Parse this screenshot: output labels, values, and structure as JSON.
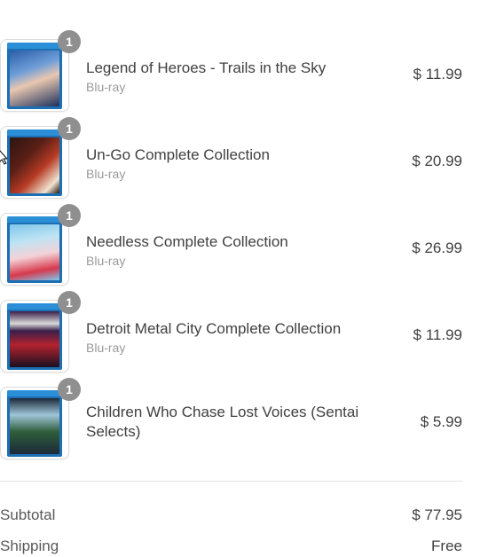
{
  "items": [
    {
      "title": "Legend of Heroes - Trails in the Sky",
      "format": "Blu-ray",
      "price": "$ 11.99",
      "quantity": "1",
      "cover_colors": [
        "#2a5ea8",
        "#e8c7b0",
        "#1b2f5c"
      ]
    },
    {
      "title": "Un-Go Complete Collection",
      "format": "Blu-ray",
      "price": "$ 20.99",
      "quantity": "1",
      "cover_colors": [
        "#2b1510",
        "#b63a24",
        "#efe3cf"
      ]
    },
    {
      "title": "Needless Complete Collection",
      "format": "Blu-ray",
      "price": "$ 26.99",
      "quantity": "1",
      "cover_colors": [
        "#7ec6ea",
        "#f3d2d7",
        "#d73a4e"
      ]
    },
    {
      "title": "Detroit Metal City Complete Collection",
      "format": "Blu-ray",
      "price": "$ 11.99",
      "quantity": "1",
      "cover_colors": [
        "#3a1f4a",
        "#d9d9d9",
        "#b2222e"
      ]
    },
    {
      "title": "Children Who Chase Lost Voices (Sentai Selects)",
      "format": "",
      "price": "$ 5.99",
      "quantity": "1",
      "cover_colors": [
        "#2f5d3a",
        "#9fc5d8",
        "#1c2a3a"
      ]
    }
  ],
  "summary": {
    "subtotal_label": "Subtotal",
    "subtotal_value": "$ 77.95",
    "shipping_label": "Shipping",
    "shipping_value": "Free"
  },
  "colors": {
    "badge": "#8f8f8f",
    "text": "#404040",
    "muted": "#9a9a9a",
    "bluray_band": "#2b8fd8"
  }
}
